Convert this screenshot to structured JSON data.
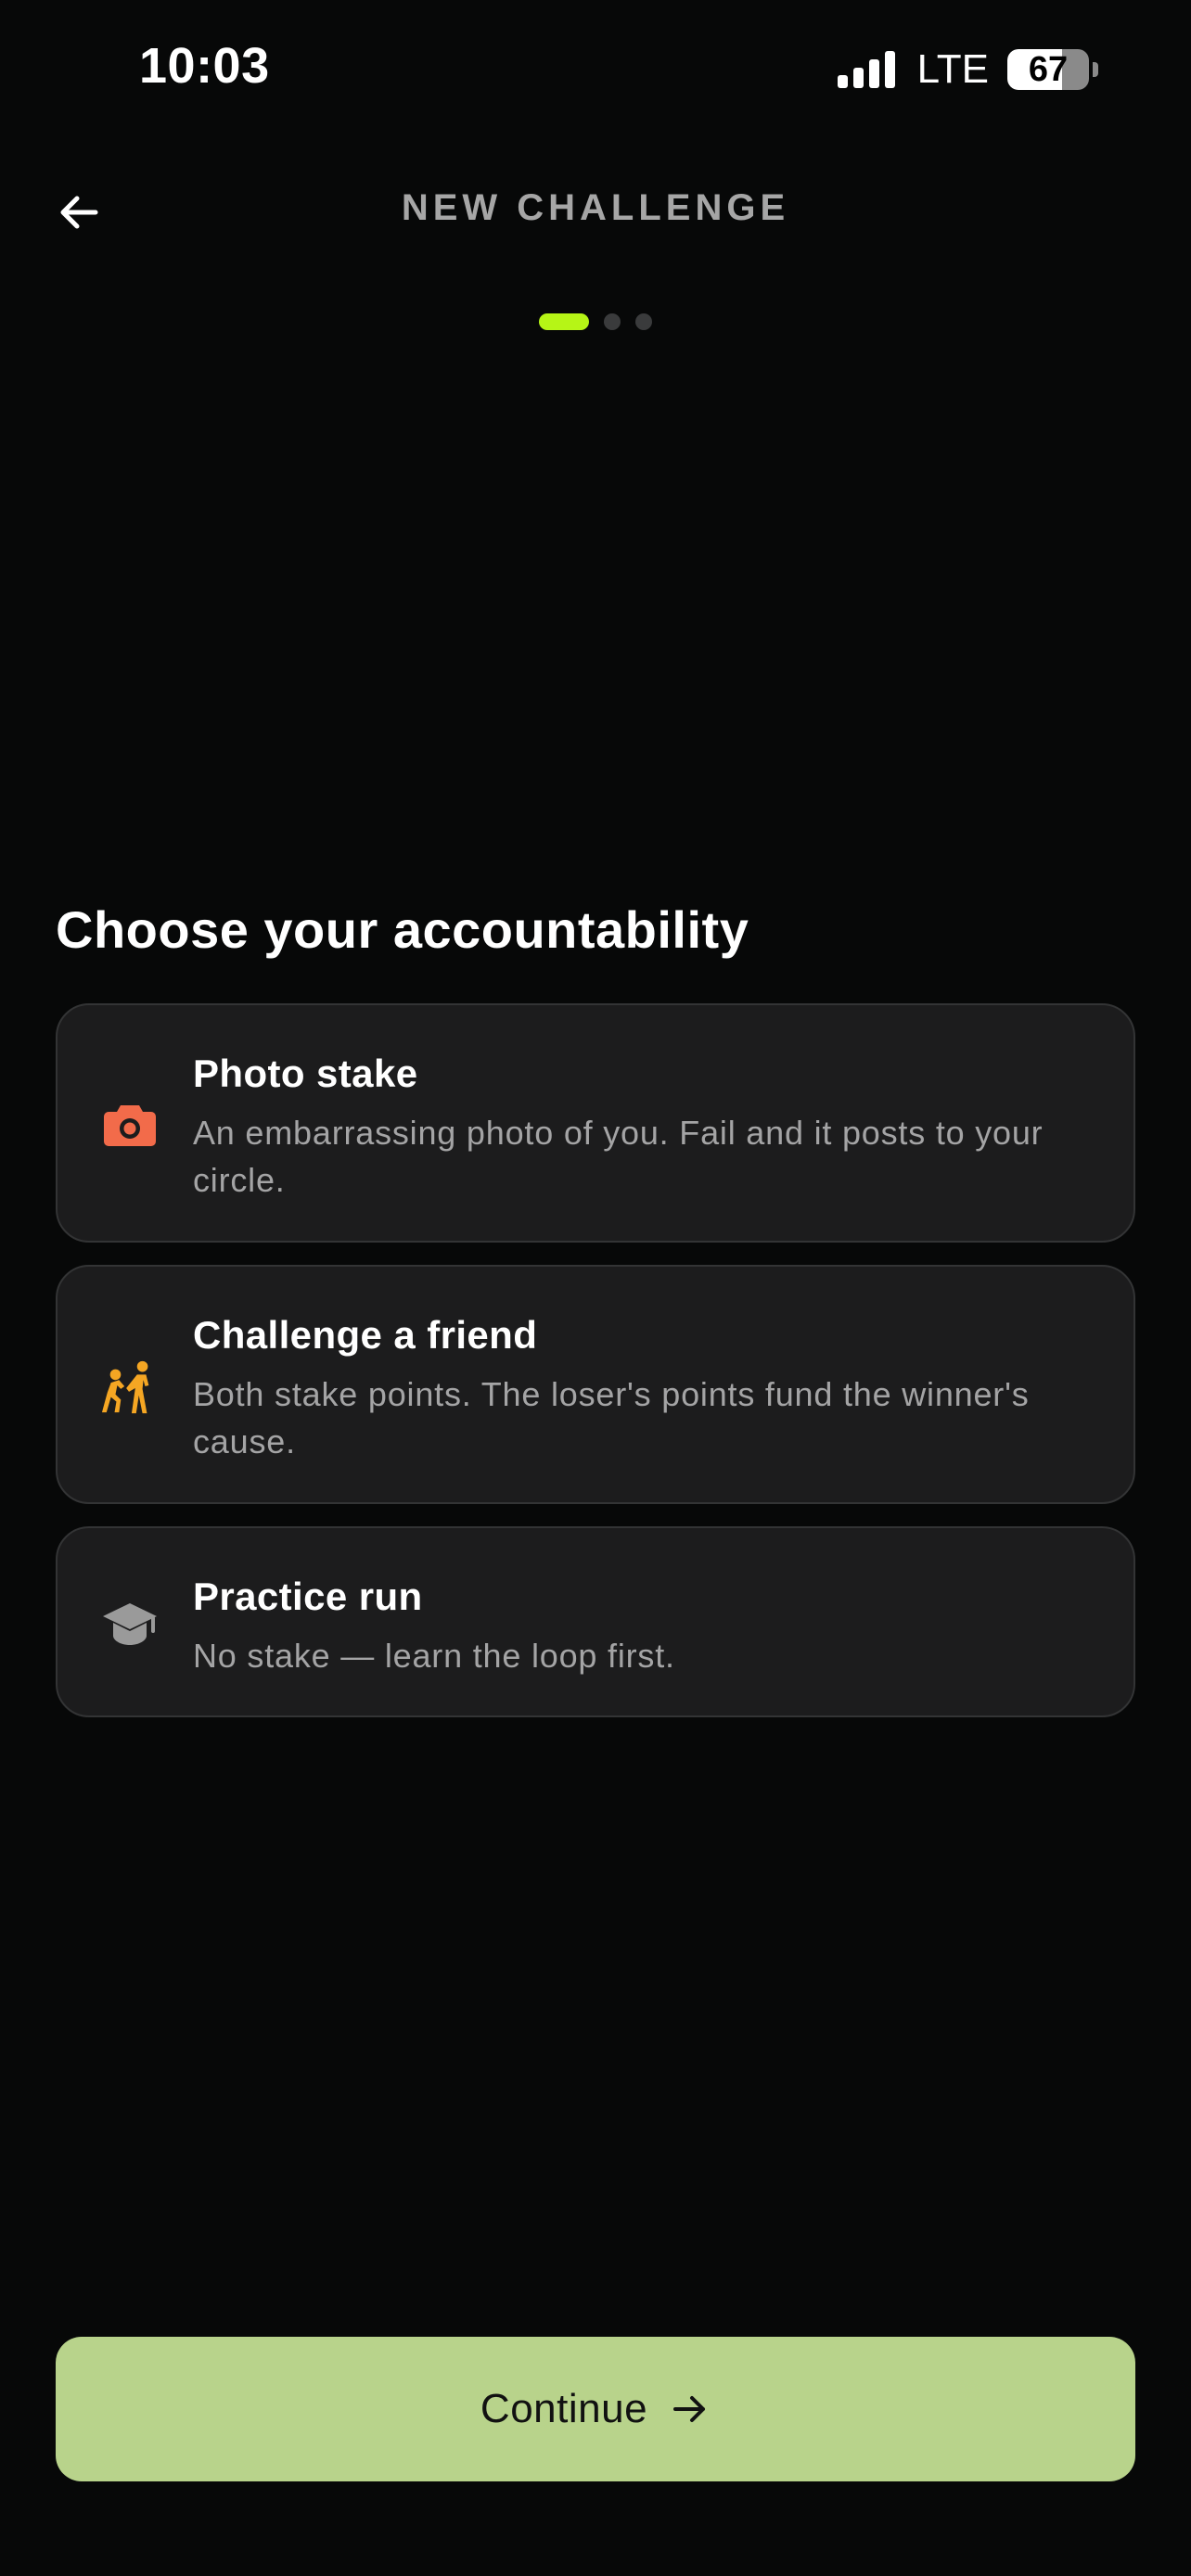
{
  "status_bar": {
    "time": "10:03",
    "network": "LTE",
    "battery": "67",
    "battery_level": 0.67,
    "signal_bars": 4
  },
  "header": {
    "title": "NEW CHALLENGE",
    "back_icon": "arrow-left-icon"
  },
  "steps": {
    "total": 3,
    "current": 1,
    "active_color": "#b6f516"
  },
  "main": {
    "heading": "Choose your accountability",
    "options": [
      {
        "title": "Photo stake",
        "description": "An embarrassing photo of you. Fail and it posts to your circle.",
        "icon": "camera-icon",
        "icon_color": "#f26b4a"
      },
      {
        "title": "Challenge a friend",
        "description": "Both stake points. The loser's points fund the winner's cause.",
        "icon": "people-icon",
        "icon_color": "#f5a623"
      },
      {
        "title": "Practice run",
        "description": "No stake — learn the loop first.",
        "icon": "graduation-cap-icon",
        "icon_color": "#9a9a9a"
      }
    ]
  },
  "footer": {
    "continue_label": "Continue",
    "continue_icon": "arrow-right-icon",
    "button_color": "#b8d38b"
  }
}
